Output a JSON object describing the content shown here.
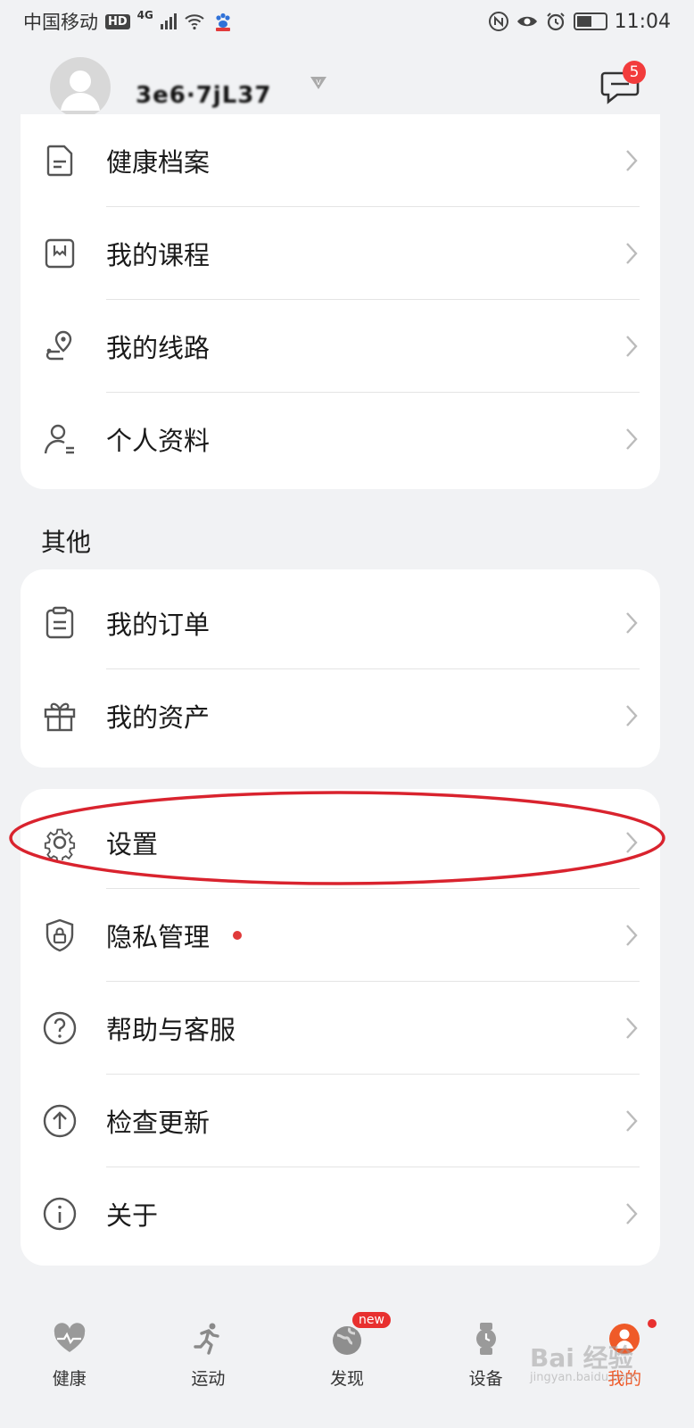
{
  "status_bar": {
    "carrier": "中国移动",
    "hd": "HD",
    "network": "4G",
    "time": "11:04"
  },
  "header": {
    "username": "3e6·7jL37",
    "message_count": "5"
  },
  "menu_top": {
    "items": [
      {
        "label": "健康档案",
        "icon": "health-record-icon"
      },
      {
        "label": "我的课程",
        "icon": "course-icon"
      },
      {
        "label": "我的线路",
        "icon": "route-icon"
      },
      {
        "label": "个人资料",
        "icon": "profile-icon"
      }
    ]
  },
  "section_other": {
    "title": "其他",
    "items": [
      {
        "label": "我的订单",
        "icon": "order-icon"
      },
      {
        "label": "我的资产",
        "icon": "gift-icon"
      }
    ]
  },
  "menu_settings": {
    "items": [
      {
        "label": "设置",
        "icon": "gear-icon"
      },
      {
        "label": "隐私管理",
        "icon": "shield-lock-icon"
      },
      {
        "label": "帮助与客服",
        "icon": "help-icon"
      },
      {
        "label": "检查更新",
        "icon": "update-icon"
      },
      {
        "label": "关于",
        "icon": "info-icon"
      }
    ]
  },
  "tabbar": {
    "tabs": [
      {
        "label": "健康",
        "icon": "heart-icon"
      },
      {
        "label": "运动",
        "icon": "runner-icon"
      },
      {
        "label": "发现",
        "icon": "globe-icon",
        "badge": "new"
      },
      {
        "label": "设备",
        "icon": "watch-icon"
      },
      {
        "label": "我的",
        "icon": "user-icon",
        "active": true
      }
    ]
  },
  "watermark": {
    "text": "Bai 经验",
    "sub": "jingyan.baidu.com"
  },
  "colors": {
    "accent": "#ef5a28",
    "badge_red": "#f23c3c",
    "highlight_ring": "#d9232e"
  }
}
